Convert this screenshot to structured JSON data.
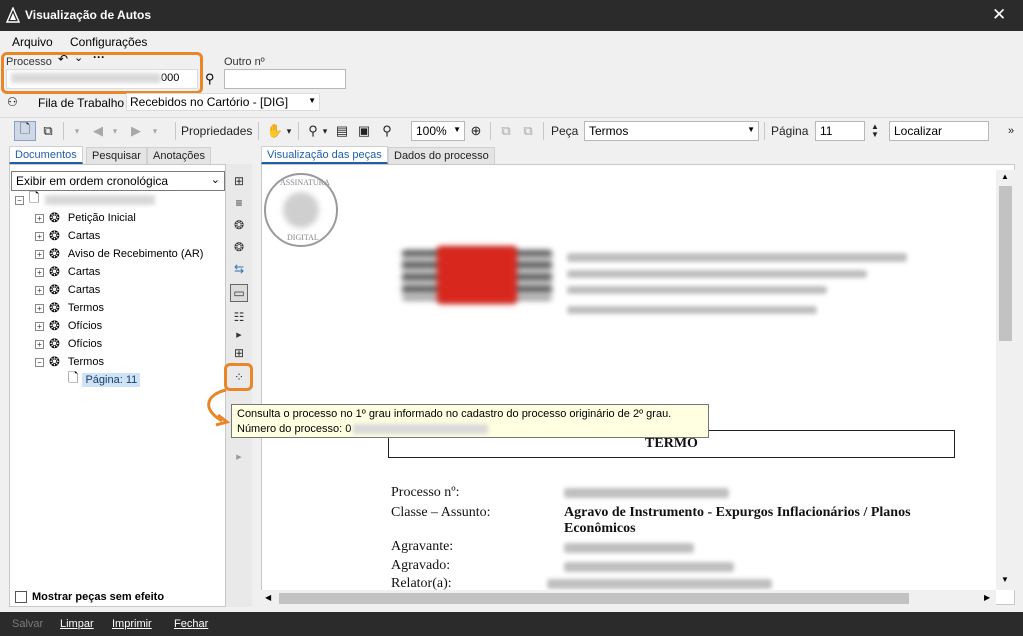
{
  "window": {
    "title": "Visualização de Autos"
  },
  "menu": {
    "arquivo": "Arquivo",
    "configuracoes": "Configurações"
  },
  "processo": {
    "label": "Processo",
    "value_suffix": "000",
    "outro_label": "Outro nº",
    "outro_value": ""
  },
  "fila": {
    "label": "Fila de Trabalho",
    "value": "Recebidos no Cartório - [DIG]"
  },
  "toolbar": {
    "propriedades": "Propriedades",
    "zoom": "100%",
    "peca_label": "Peça",
    "peca_value": "Termos",
    "pagina_label": "Página",
    "pagina_value": "11",
    "localizar_placeholder": "Localizar"
  },
  "left_tabs": {
    "documentos": "Documentos",
    "pesquisar": "Pesquisar",
    "anotacoes": "Anotações"
  },
  "order_select": "Exibir em ordem cronológica",
  "tree": {
    "items": [
      "Petição Inicial",
      "Cartas",
      "Aviso de Recebimento (AR)",
      "Cartas",
      "Cartas",
      "Termos",
      "Ofícios",
      "Ofícios",
      "Termos"
    ],
    "selected_page": "Página: 11"
  },
  "mostrar_pecas": "Mostrar peças sem efeito",
  "view_tabs": {
    "visualizacao": "Visualização das peças",
    "dados": "Dados do processo"
  },
  "tooltip": {
    "line1": "Consulta o processo no 1º grau informado no cadastro do processo originário de 2º grau.",
    "line2_prefix": "Número do processo: 0"
  },
  "stamp": {
    "top": "ASSINATURA",
    "bottom": "DIGITAL"
  },
  "document": {
    "title": "TERMO",
    "fields": {
      "processo": "Processo nº:",
      "classe": "Classe – Assunto:",
      "classe_value": "Agravo de Instrumento - Expurgos Inflacionários / Planos Econômicos",
      "agravante": "Agravante:",
      "agravado": "Agravado:",
      "relator": "Relator(a):"
    }
  },
  "bottom": {
    "salvar": "Salvar",
    "limpar": "Limpar",
    "imprimir": "Imprimir",
    "fechar": "Fechar"
  },
  "colors": {
    "accent": "#e8872a",
    "titlebar": "#2b2b2b",
    "tab_active": "#1f5fa8",
    "tooltip_bg": "#ffffe1"
  }
}
